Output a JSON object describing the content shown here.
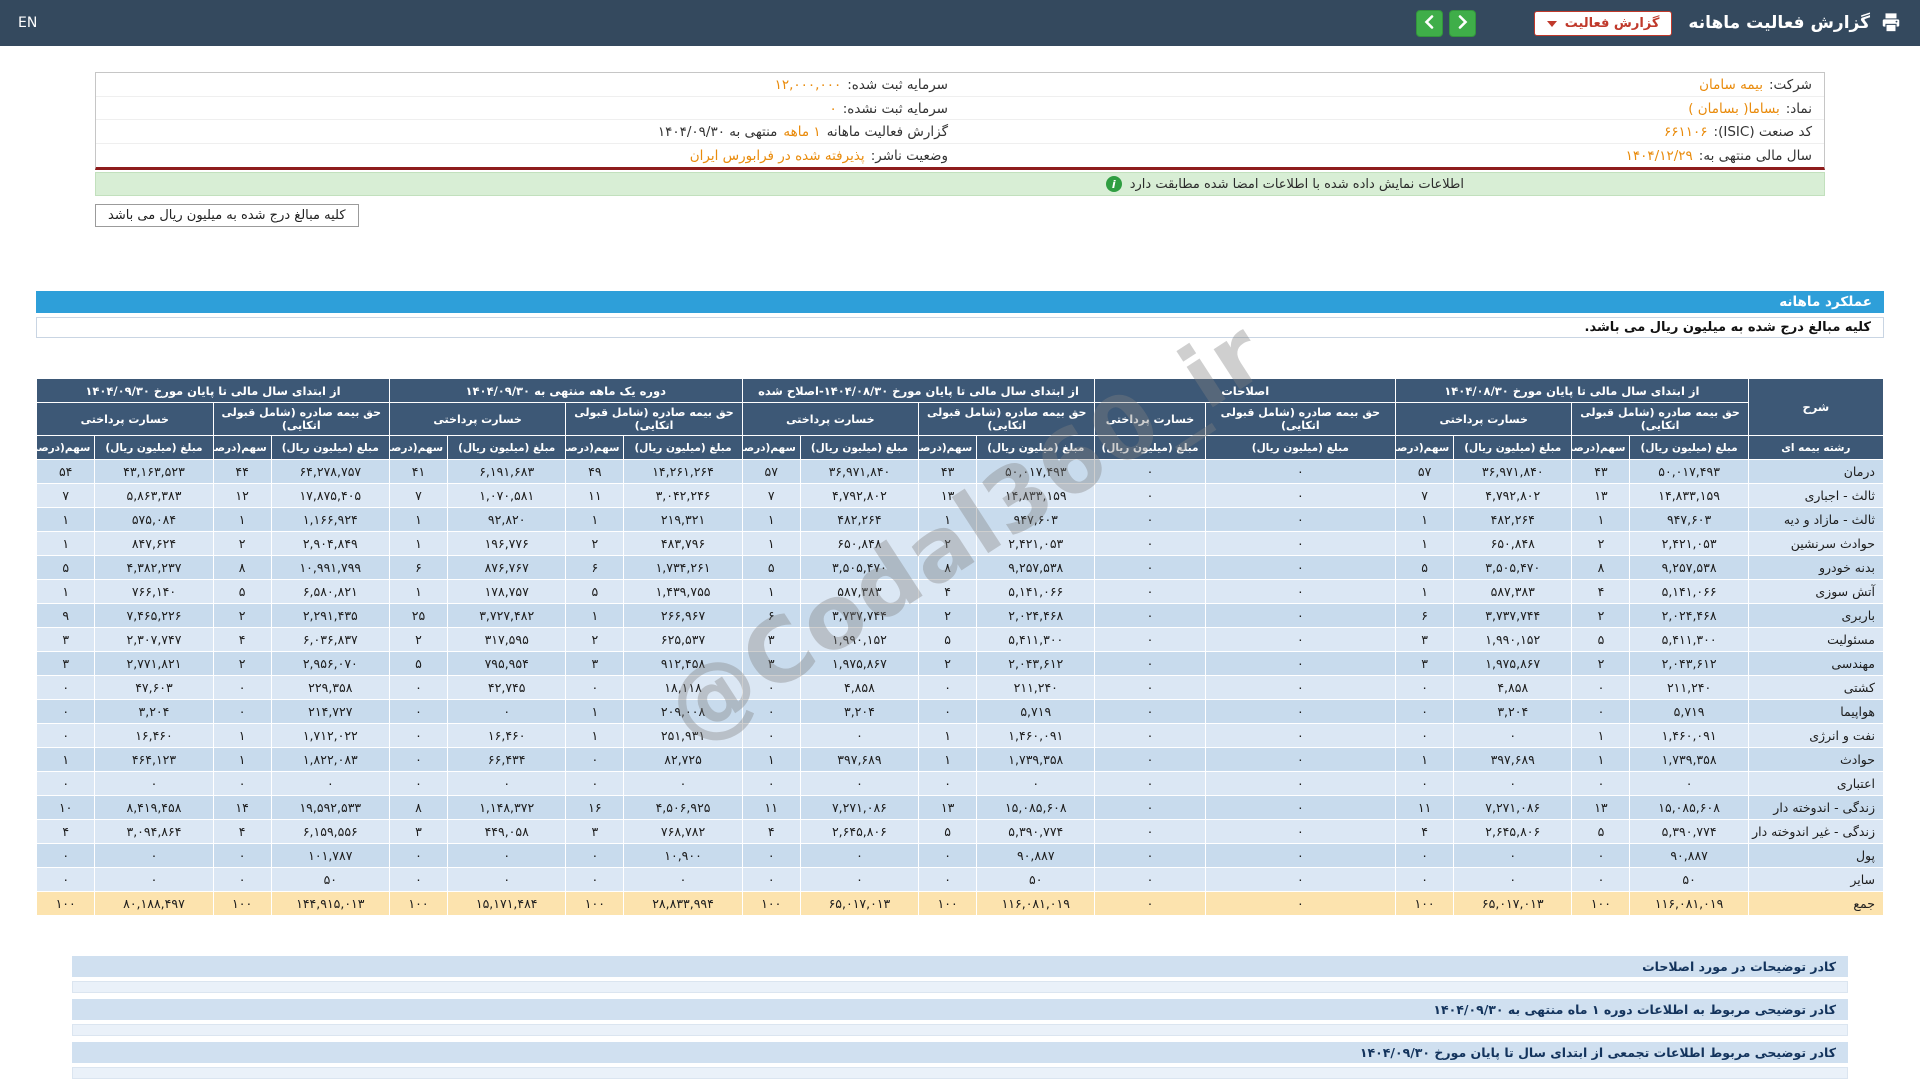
{
  "header": {
    "title": "گزارش فعالیت ماهانه",
    "report_button_label": "گزارش فعالیت",
    "language_toggle": "EN"
  },
  "company_info": {
    "col_right": [
      {
        "label": "شرکت:",
        "value": "بیمه سامان"
      },
      {
        "label": "نماد:",
        "value": "بساما( بسامان )"
      },
      {
        "label": "کد صنعت (ISIC):",
        "value": "۶۶۱۱۰۶"
      },
      {
        "label": "سال مالی منتهی به:",
        "value": "۱۴۰۴/۱۲/۲۹"
      }
    ],
    "col_left": [
      {
        "label": "سرمایه ثبت شده:",
        "value": "۱۲,۰۰۰,۰۰۰"
      },
      {
        "label": "سرمایه ثبت نشده:",
        "value": "۰"
      },
      {
        "label": "گزارش فعالیت ماهانه",
        "value": "۱ ماهه",
        "suffix": "منتهی به ۱۴۰۴/۰۹/۳۰"
      },
      {
        "label": "وضعیت ناشر:",
        "value": "پذیرفته شده در فرابورس ایران"
      }
    ]
  },
  "signature_banner": "اطلاعات نمایش داده شده با اطلاعات امضا شده مطابقت دارد",
  "amounts_note_box": "کلیه مبالغ درج شده به میلیون ریال می باشد",
  "section": {
    "title": "عملکرد ماهانه",
    "amounts_note": "کلیه مبالغ درج شده به میلیون ریال می باشد."
  },
  "watermark": "@Codal360_ir",
  "colors": {
    "topbar": "#34495e",
    "table_header": "#3d5876",
    "section_blue": "#2e9fd9",
    "row_odd": "#c8dbed",
    "row_even": "#dbe7f4",
    "total_row": "#fce3ae",
    "banner_green": "#d8eed5",
    "value_orange": "#e98b0c",
    "button_red": "#c0392b",
    "nav_green": "#3fae49",
    "divider_maroon": "#8e1c1c"
  },
  "table": {
    "label_col": {
      "top": "شرح",
      "bottom": "رشته بیمه ای"
    },
    "sub_premium": "حق بیمه صادره (شامل قبولی اتکایی)",
    "sub_claims": "خسارت پرداختی",
    "amount_label": "مبلغ (میلیون ریال)",
    "share_label": "سهم(درصد)",
    "groups": [
      {
        "title": "از ابتدای سال مالی تا پایان مورخ ۱۴۰۴/۰۸/۳۰",
        "type": "full"
      },
      {
        "title": "اصلاحات",
        "type": "amounts_only"
      },
      {
        "title": "از ابتدای سال مالی تا پایان مورخ ۱۴۰۴/۰۸/۳۰-اصلاح شده",
        "type": "full"
      },
      {
        "title": "دوره یک ماهه منتهی به ۱۴۰۴/۰۹/۳۰",
        "type": "full"
      },
      {
        "title": "از ابتدای سال مالی تا پایان مورخ ۱۴۰۴/۰۹/۳۰",
        "type": "full"
      }
    ],
    "rows": [
      {
        "label": "درمان",
        "values": [
          "۵۰,۰۱۷,۴۹۳",
          "۴۳",
          "۳۶,۹۷۱,۸۴۰",
          "۵۷",
          "۰",
          "۰",
          "۵۰,۰۱۷,۴۹۳",
          "۴۳",
          "۳۶,۹۷۱,۸۴۰",
          "۵۷",
          "۱۴,۲۶۱,۲۶۴",
          "۴۹",
          "۶,۱۹۱,۶۸۳",
          "۴۱",
          "۶۴,۲۷۸,۷۵۷",
          "۴۴",
          "۴۳,۱۶۳,۵۲۳",
          "۵۴"
        ]
      },
      {
        "label": "ثالث - اجباری",
        "values": [
          "۱۴,۸۳۳,۱۵۹",
          "۱۳",
          "۴,۷۹۲,۸۰۲",
          "۷",
          "۰",
          "۰",
          "۱۴,۸۳۳,۱۵۹",
          "۱۳",
          "۴,۷۹۲,۸۰۲",
          "۷",
          "۳,۰۴۲,۲۴۶",
          "۱۱",
          "۱,۰۷۰,۵۸۱",
          "۷",
          "۱۷,۸۷۵,۴۰۵",
          "۱۲",
          "۵,۸۶۳,۳۸۳",
          "۷"
        ]
      },
      {
        "label": "ثالث - مازاد و دیه",
        "values": [
          "۹۴۷,۶۰۳",
          "۱",
          "۴۸۲,۲۶۴",
          "۱",
          "۰",
          "۰",
          "۹۴۷,۶۰۳",
          "۱",
          "۴۸۲,۲۶۴",
          "۱",
          "۲۱۹,۳۲۱",
          "۱",
          "۹۲,۸۲۰",
          "۱",
          "۱,۱۶۶,۹۲۴",
          "۱",
          "۵۷۵,۰۸۴",
          "۱"
        ]
      },
      {
        "label": "حوادث سرنشین",
        "values": [
          "۲,۴۲۱,۰۵۳",
          "۲",
          "۶۵۰,۸۴۸",
          "۱",
          "۰",
          "۰",
          "۲,۴۲۱,۰۵۳",
          "۲",
          "۶۵۰,۸۴۸",
          "۱",
          "۴۸۳,۷۹۶",
          "۲",
          "۱۹۶,۷۷۶",
          "۱",
          "۲,۹۰۴,۸۴۹",
          "۲",
          "۸۴۷,۶۲۴",
          "۱"
        ]
      },
      {
        "label": "بدنه خودرو",
        "values": [
          "۹,۲۵۷,۵۳۸",
          "۸",
          "۳,۵۰۵,۴۷۰",
          "۵",
          "۰",
          "۰",
          "۹,۲۵۷,۵۳۸",
          "۸",
          "۳,۵۰۵,۴۷۰",
          "۵",
          "۱,۷۳۴,۲۶۱",
          "۶",
          "۸۷۶,۷۶۷",
          "۶",
          "۱۰,۹۹۱,۷۹۹",
          "۸",
          "۴,۳۸۲,۲۳۷",
          "۵"
        ]
      },
      {
        "label": "آتش سوزی",
        "values": [
          "۵,۱۴۱,۰۶۶",
          "۴",
          "۵۸۷,۳۸۳",
          "۱",
          "۰",
          "۰",
          "۵,۱۴۱,۰۶۶",
          "۴",
          "۵۸۷,۳۸۳",
          "۱",
          "۱,۴۳۹,۷۵۵",
          "۵",
          "۱۷۸,۷۵۷",
          "۱",
          "۶,۵۸۰,۸۲۱",
          "۵",
          "۷۶۶,۱۴۰",
          "۱"
        ]
      },
      {
        "label": "باربری",
        "values": [
          "۲,۰۲۴,۴۶۸",
          "۲",
          "۳,۷۳۷,۷۴۴",
          "۶",
          "۰",
          "۰",
          "۲,۰۲۴,۴۶۸",
          "۲",
          "۳,۷۳۷,۷۴۴",
          "۶",
          "۲۶۶,۹۶۷",
          "۱",
          "۳,۷۲۷,۴۸۲",
          "۲۵",
          "۲,۲۹۱,۴۳۵",
          "۲",
          "۷,۴۶۵,۲۲۶",
          "۹"
        ]
      },
      {
        "label": "مسئولیت",
        "values": [
          "۵,۴۱۱,۳۰۰",
          "۵",
          "۱,۹۹۰,۱۵۲",
          "۳",
          "۰",
          "۰",
          "۵,۴۱۱,۳۰۰",
          "۵",
          "۱,۹۹۰,۱۵۲",
          "۳",
          "۶۲۵,۵۳۷",
          "۲",
          "۳۱۷,۵۹۵",
          "۲",
          "۶,۰۳۶,۸۳۷",
          "۴",
          "۲,۳۰۷,۷۴۷",
          "۳"
        ]
      },
      {
        "label": "مهندسی",
        "values": [
          "۲,۰۴۳,۶۱۲",
          "۲",
          "۱,۹۷۵,۸۶۷",
          "۳",
          "۰",
          "۰",
          "۲,۰۴۳,۶۱۲",
          "۲",
          "۱,۹۷۵,۸۶۷",
          "۳",
          "۹۱۲,۴۵۸",
          "۳",
          "۷۹۵,۹۵۴",
          "۵",
          "۲,۹۵۶,۰۷۰",
          "۲",
          "۲,۷۷۱,۸۲۱",
          "۳"
        ]
      },
      {
        "label": "کشتی",
        "values": [
          "۲۱۱,۲۴۰",
          "۰",
          "۴,۸۵۸",
          "۰",
          "۰",
          "۰",
          "۲۱۱,۲۴۰",
          "۰",
          "۴,۸۵۸",
          "۰",
          "۱۸,۱۱۸",
          "۰",
          "۴۲,۷۴۵",
          "۰",
          "۲۲۹,۳۵۸",
          "۰",
          "۴۷,۶۰۳",
          "۰"
        ]
      },
      {
        "label": "هواپیما",
        "values": [
          "۵,۷۱۹",
          "۰",
          "۳,۲۰۴",
          "۰",
          "۰",
          "۰",
          "۵,۷۱۹",
          "۰",
          "۳,۲۰۴",
          "۰",
          "۲۰۹,۰۰۸",
          "۱",
          "۰",
          "۰",
          "۲۱۴,۷۲۷",
          "۰",
          "۳,۲۰۴",
          "۰"
        ]
      },
      {
        "label": "نفت و انرژی",
        "values": [
          "۱,۴۶۰,۰۹۱",
          "۱",
          "۰",
          "۰",
          "۰",
          "۰",
          "۱,۴۶۰,۰۹۱",
          "۱",
          "۰",
          "۰",
          "۲۵۱,۹۳۱",
          "۱",
          "۱۶,۴۶۰",
          "۰",
          "۱,۷۱۲,۰۲۲",
          "۱",
          "۱۶,۴۶۰",
          "۰"
        ]
      },
      {
        "label": "حوادث",
        "values": [
          "۱,۷۳۹,۳۵۸",
          "۱",
          "۳۹۷,۶۸۹",
          "۱",
          "۰",
          "۰",
          "۱,۷۳۹,۳۵۸",
          "۱",
          "۳۹۷,۶۸۹",
          "۱",
          "۸۲,۷۲۵",
          "۰",
          "۶۶,۴۳۴",
          "۰",
          "۱,۸۲۲,۰۸۳",
          "۱",
          "۴۶۴,۱۲۳",
          "۱"
        ]
      },
      {
        "label": "اعتباری",
        "values": [
          "۰",
          "۰",
          "۰",
          "۰",
          "۰",
          "۰",
          "۰",
          "۰",
          "۰",
          "۰",
          "۰",
          "۰",
          "۰",
          "۰",
          "۰",
          "۰",
          "۰",
          "۰"
        ]
      },
      {
        "label": "زندگی - اندوخته دار",
        "values": [
          "۱۵,۰۸۵,۶۰۸",
          "۱۳",
          "۷,۲۷۱,۰۸۶",
          "۱۱",
          "۰",
          "۰",
          "۱۵,۰۸۵,۶۰۸",
          "۱۳",
          "۷,۲۷۱,۰۸۶",
          "۱۱",
          "۴,۵۰۶,۹۲۵",
          "۱۶",
          "۱,۱۴۸,۳۷۲",
          "۸",
          "۱۹,۵۹۲,۵۳۳",
          "۱۴",
          "۸,۴۱۹,۴۵۸",
          "۱۰"
        ]
      },
      {
        "label": "زندگی - غیر اندوخته دار",
        "values": [
          "۵,۳۹۰,۷۷۴",
          "۵",
          "۲,۶۴۵,۸۰۶",
          "۴",
          "۰",
          "۰",
          "۵,۳۹۰,۷۷۴",
          "۵",
          "۲,۶۴۵,۸۰۶",
          "۴",
          "۷۶۸,۷۸۲",
          "۳",
          "۴۴۹,۰۵۸",
          "۳",
          "۶,۱۵۹,۵۵۶",
          "۴",
          "۳,۰۹۴,۸۶۴",
          "۴"
        ]
      },
      {
        "label": "پول",
        "values": [
          "۹۰,۸۸۷",
          "۰",
          "۰",
          "۰",
          "۰",
          "۰",
          "۹۰,۸۸۷",
          "۰",
          "۰",
          "۰",
          "۱۰,۹۰۰",
          "۰",
          "۰",
          "۰",
          "۱۰۱,۷۸۷",
          "۰",
          "۰",
          "۰"
        ]
      },
      {
        "label": "سایر",
        "values": [
          "۵۰",
          "۰",
          "۰",
          "۰",
          "۰",
          "۰",
          "۵۰",
          "۰",
          "۰",
          "۰",
          "۰",
          "۰",
          "۰",
          "۰",
          "۵۰",
          "۰",
          "۰",
          "۰"
        ]
      },
      {
        "label": "جمع",
        "total": true,
        "values": [
          "۱۱۶,۰۸۱,۰۱۹",
          "۱۰۰",
          "۶۵,۰۱۷,۰۱۳",
          "۱۰۰",
          "۰",
          "۰",
          "۱۱۶,۰۸۱,۰۱۹",
          "۱۰۰",
          "۶۵,۰۱۷,۰۱۳",
          "۱۰۰",
          "۲۸,۸۳۳,۹۹۴",
          "۱۰۰",
          "۱۵,۱۷۱,۴۸۴",
          "۱۰۰",
          "۱۴۴,۹۱۵,۰۱۳",
          "۱۰۰",
          "۸۰,۱۸۸,۴۹۷",
          "۱۰۰"
        ]
      }
    ]
  },
  "notes": [
    {
      "title": "کادر توضیحات در مورد اصلاحات"
    },
    {
      "title": "کادر توضیحی مربوط به اطلاعات دوره ۱ ماه منتهی به ۱۴۰۴/۰۹/۳۰"
    },
    {
      "title": "کادر توضیحی مربوط اطلاعات تجمعی از ابتدای سال تا پایان مورخ ۱۴۰۴/۰۹/۳۰"
    }
  ]
}
